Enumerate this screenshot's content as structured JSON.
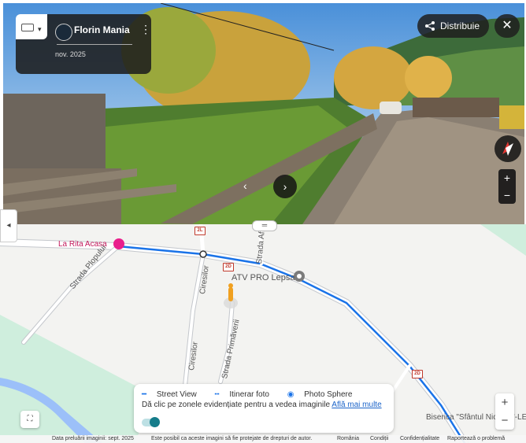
{
  "street_view": {
    "author": "Florin Mania",
    "date": "nov. 2025",
    "share_label": "Distribuie",
    "close_label": "✕",
    "zoom_in": "+",
    "zoom_out": "−",
    "keyboard_caret": "▾",
    "menu_dots": "⋮",
    "next_arrow": "›",
    "prev_arrow": "‹"
  },
  "map": {
    "places": {
      "la_rita": "La Rita Acasa",
      "atv": "ATV PRO Lepsa",
      "biserica": "Biserica \"Sfântul Nicolae\"-LEPSA"
    },
    "streets": {
      "plopului": "Strada Plopului",
      "ciresilor1": "Ciresilor",
      "ciresilor2": "Ciresilor",
      "primaverii": "Strada Primăverii",
      "afinului": "Strada Afinului"
    },
    "road_shields": [
      "2L",
      "2D",
      "2D"
    ],
    "legend": {
      "street_view": "Street View",
      "itinerar": "Itinerar foto",
      "photo_sphere": "Photo Sphere",
      "help_text": "Dă clic pe zonele evidențiate pentru a vedea imaginile",
      "learn_more": "Află mai multe"
    },
    "zoom_in": "+",
    "zoom_out": "−",
    "side_tab": "◂",
    "drag_handle": "═"
  },
  "footer": {
    "data": "Data preluării imaginii: sept. 2025",
    "notice": "Este posibil ca aceste imagini să fie protejate de drepturi de autor.",
    "country": "România",
    "terms": "Condiții",
    "privacy": "Confidențialitate",
    "report": "Raportează o problemă"
  },
  "colors": {
    "road": "#ffffff",
    "road_edge": "#c4c7cc",
    "green_area": "#cfeedd",
    "water": "#9cc0f9",
    "street_view_line": "#1a73e8",
    "poi_pink": "#e91e8c"
  }
}
